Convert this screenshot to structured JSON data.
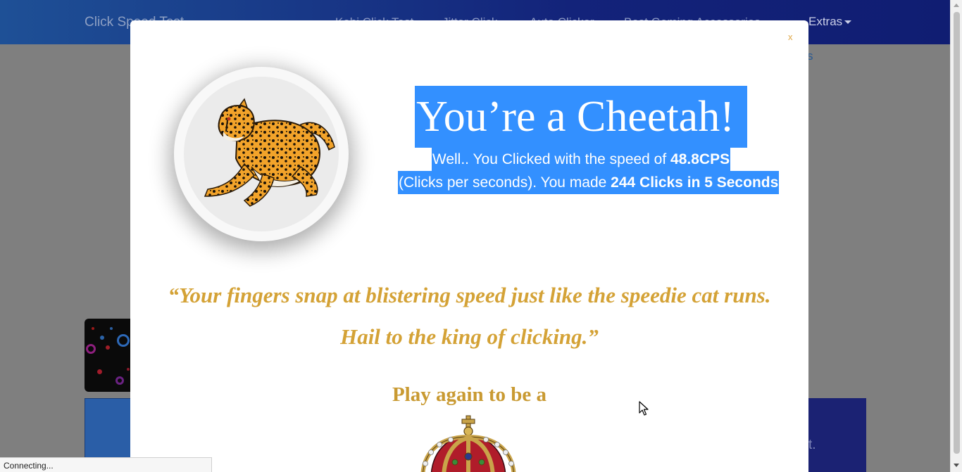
{
  "navbar": {
    "brand": "Click Speed Test",
    "links": [
      "Kohi Click Test",
      "Jitter Click",
      "Auto Clicker",
      "Best Gaming Accessories"
    ],
    "extras_label": "Extras"
  },
  "background": {
    "link_text": "s",
    "card_text": "t."
  },
  "modal": {
    "close_label": "x",
    "title": "You’re a Cheetah!",
    "line1_prefix": "Well.. You Clicked with the speed of ",
    "cps": "48.8CPS",
    "line2_prefix": "(Clicks per seconds). You made ",
    "clicks_summary": "244 Clicks in 5 Seconds",
    "quote_line1": "“Your fingers snap at blistering speed just like the speedie cat runs.",
    "quote_line2": "Hail to the king of clicking.”",
    "play_again": "Play again to be a",
    "badge_icon": "cheetah-icon",
    "next_rank_icon": "crown-icon"
  },
  "status_bar": {
    "text": "Connecting..."
  },
  "colors": {
    "selection": "#3390ff",
    "quote_gold": "#d4a236",
    "close_orange": "#e0a94a",
    "navbar_dark": "#13237a"
  }
}
